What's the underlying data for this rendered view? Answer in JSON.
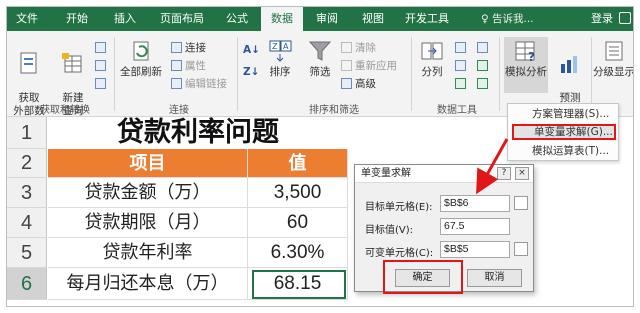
{
  "tabs": [
    "文件",
    "开始",
    "插入",
    "页面布局",
    "公式",
    "数据",
    "审阅",
    "视图",
    "开发工具"
  ],
  "active_tab": "数据",
  "tell_me": "告诉我...",
  "login": "登录",
  "ribbon": {
    "get_data": "获取\n外部数据",
    "new_query": "新建\n查询",
    "refresh_all": "全部刷新",
    "connections": "连接",
    "properties": "属性",
    "edit_links": "编辑链接",
    "sort": "排序",
    "filter": "筛选",
    "clear": "清除",
    "reapply": "重新应用",
    "advanced": "高级",
    "split": "分列",
    "what_if": "模拟分析",
    "forecast": "预测\n工作表",
    "outline": "分级显示",
    "groups": {
      "get_transform": "获取和转换",
      "connections": "连接",
      "sort_filter": "排序和筛选",
      "data_tools": "数据工具"
    }
  },
  "menu": {
    "items": [
      "方案管理器(S)...",
      "单变量求解(G)...",
      "模拟运算表(T)..."
    ]
  },
  "sheet": {
    "rows": [
      "1",
      "2",
      "3",
      "4",
      "5",
      "6"
    ],
    "title": "贷款利率问题",
    "header_item": "项目",
    "header_value": "值",
    "items": [
      {
        "label": "贷款金额（万）",
        "value": "3,500"
      },
      {
        "label": "贷款期限（月）",
        "value": "60"
      },
      {
        "label": "贷款年利率",
        "value": "6.30%"
      },
      {
        "label": "每月归还本息（万）",
        "value": "68.15"
      }
    ]
  },
  "dialog": {
    "title": "单变量求解",
    "help": "?",
    "close": "×",
    "target_cell_label": "目标单元格(E):",
    "target_cell_value": "$B$6",
    "target_value_label": "目标值(V):",
    "target_value_value": "67.5",
    "variable_cell_label": "可变单元格(C):",
    "variable_cell_value": "$B$5",
    "ok": "确定",
    "cancel": "取消"
  }
}
